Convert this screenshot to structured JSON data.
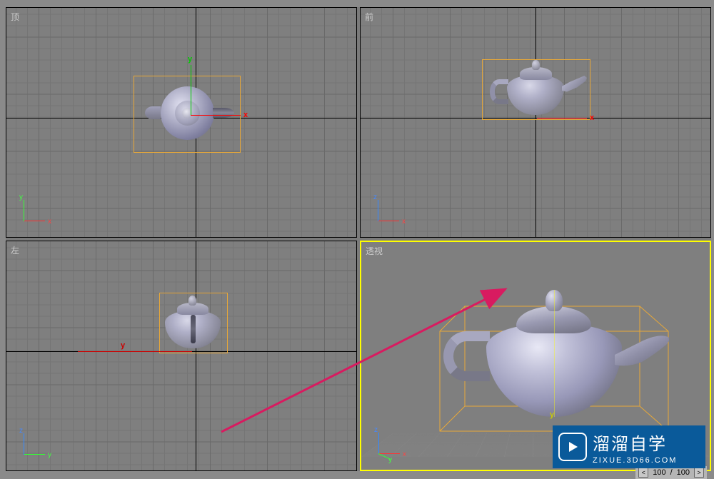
{
  "viewports": {
    "top": {
      "label": "顶",
      "axis1": "y",
      "axis2": "x"
    },
    "front": {
      "label": "前",
      "axis1": "z",
      "axis2": "x"
    },
    "left": {
      "label": "左",
      "axis1": "z",
      "axis2": "y"
    },
    "perspective": {
      "label": "透视",
      "axis1": "z",
      "axis2": "x"
    }
  },
  "axis_labels": {
    "x": "x",
    "y": "y",
    "z": "z"
  },
  "watermark": {
    "title": "溜溜自学",
    "url": "ZIXUE.3D66.COM"
  },
  "timeline": {
    "current": "100",
    "total": "100",
    "separator": "/"
  }
}
